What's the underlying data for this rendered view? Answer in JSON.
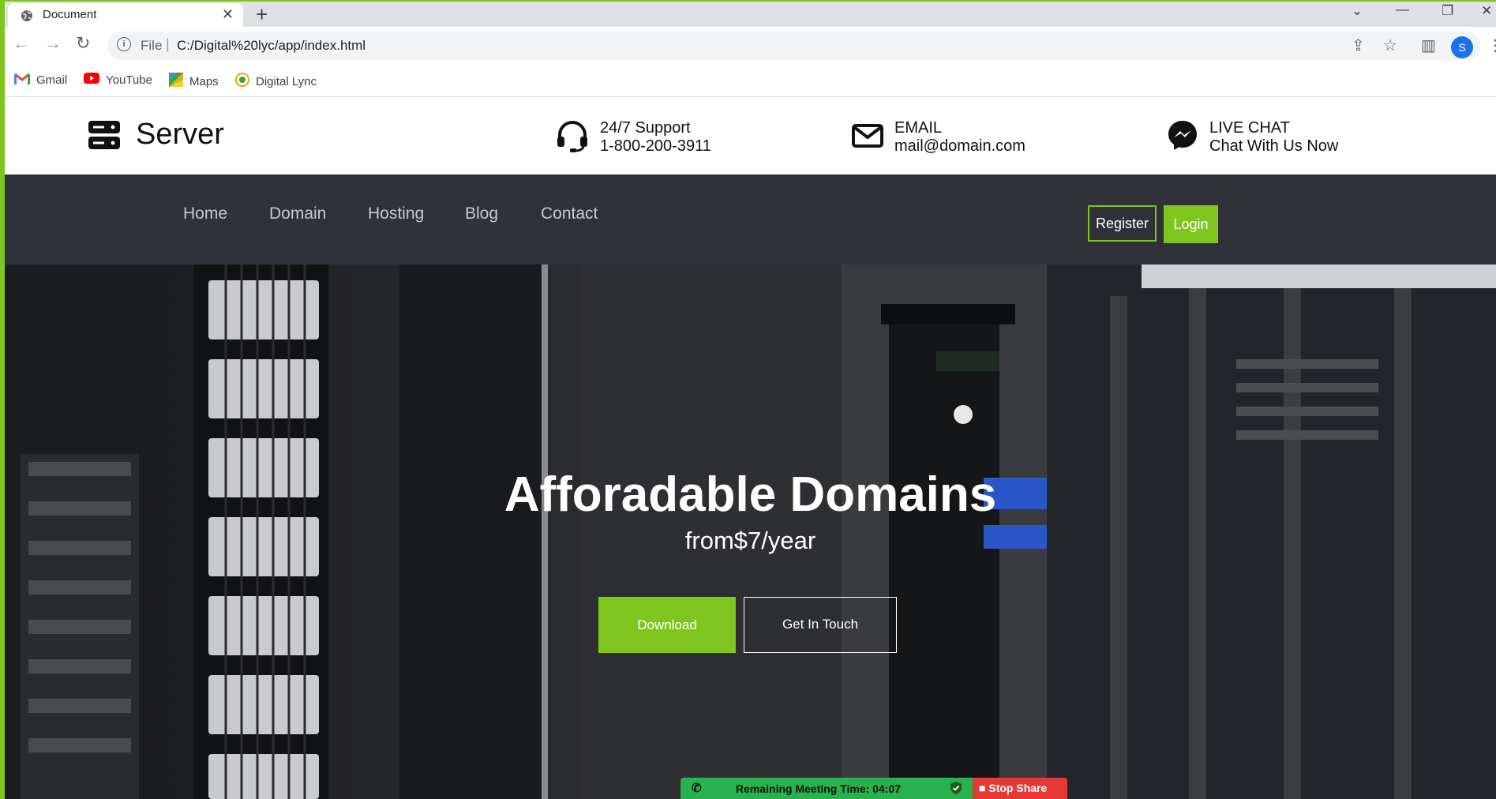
{
  "browser": {
    "tab_title": "Document",
    "address_scheme": "File",
    "url": "C:/Digital%20lyc/app/index.html",
    "profile_initial": "S",
    "bookmarks": [
      {
        "label": "Gmail",
        "icon": "gmail-icon"
      },
      {
        "label": "YouTube",
        "icon": "youtube-icon"
      },
      {
        "label": "Maps",
        "icon": "maps-icon"
      },
      {
        "label": "Digital Lync",
        "icon": "digital-lync-icon"
      }
    ]
  },
  "header": {
    "brand": "Server",
    "support": {
      "title": "24/7 Support",
      "value": "1-800-200-3911"
    },
    "email": {
      "title": "EMAIL",
      "value": "mail@domain.com"
    },
    "chat": {
      "title": "LIVE CHAT",
      "value": "Chat With Us Now"
    }
  },
  "nav": {
    "links": [
      "Home",
      "Domain",
      "Hosting",
      "Blog",
      "Contact"
    ],
    "register": "Register",
    "login": "Login"
  },
  "hero": {
    "title": "Afforadable Domains",
    "subtitle": "from$7/year",
    "primary_button": "Download",
    "secondary_button": "Get In Touch"
  },
  "meeting_bar": {
    "remaining": "Remaining Meeting Time: 04:07",
    "stop": "Stop Share"
  },
  "colors": {
    "accent": "#7ec61e",
    "nav_bg": "#2f3238",
    "meeting_green": "#28b14c",
    "stop_red": "#e53935"
  }
}
